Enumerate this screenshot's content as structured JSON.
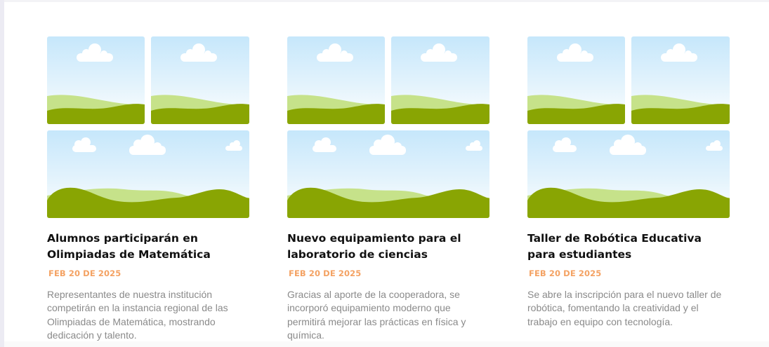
{
  "colors": {
    "title": "#111111",
    "date": "#f4a263",
    "description": "#8a8a8a",
    "sky": "#c6e7fb",
    "hill_dark": "#89a503",
    "hill_light": "#c6e28a"
  },
  "news": [
    {
      "title": "Alumnos participarán en Olimpiadas de Matemática",
      "date": "FEB 20 DE 2025",
      "description": "Representantes de nuestra institución competirán en la instancia regional de las Olimpiadas de Matemática, mostrando dedicación y talento.",
      "images": [
        "landscape-placeholder-image",
        "landscape-placeholder-image",
        "landscape-placeholder-image"
      ]
    },
    {
      "title": "Nuevo equipamiento para el laboratorio de ciencias",
      "date": "FEB 20 DE 2025",
      "description": "Gracias al aporte de la cooperadora, se incorporó equipamiento moderno que permitirá mejorar las prácticas en física y química.",
      "images": [
        "landscape-placeholder-image",
        "landscape-placeholder-image",
        "landscape-placeholder-image"
      ]
    },
    {
      "title": "Taller de Robótica Educativa para estudiantes",
      "date": "FEB 20 DE 2025",
      "description": "Se abre la inscripción para el nuevo taller de robótica, fomentando la creatividad y el trabajo en equipo con tecnología.",
      "images": [
        "landscape-placeholder-image",
        "landscape-placeholder-image",
        "landscape-placeholder-image"
      ]
    }
  ]
}
